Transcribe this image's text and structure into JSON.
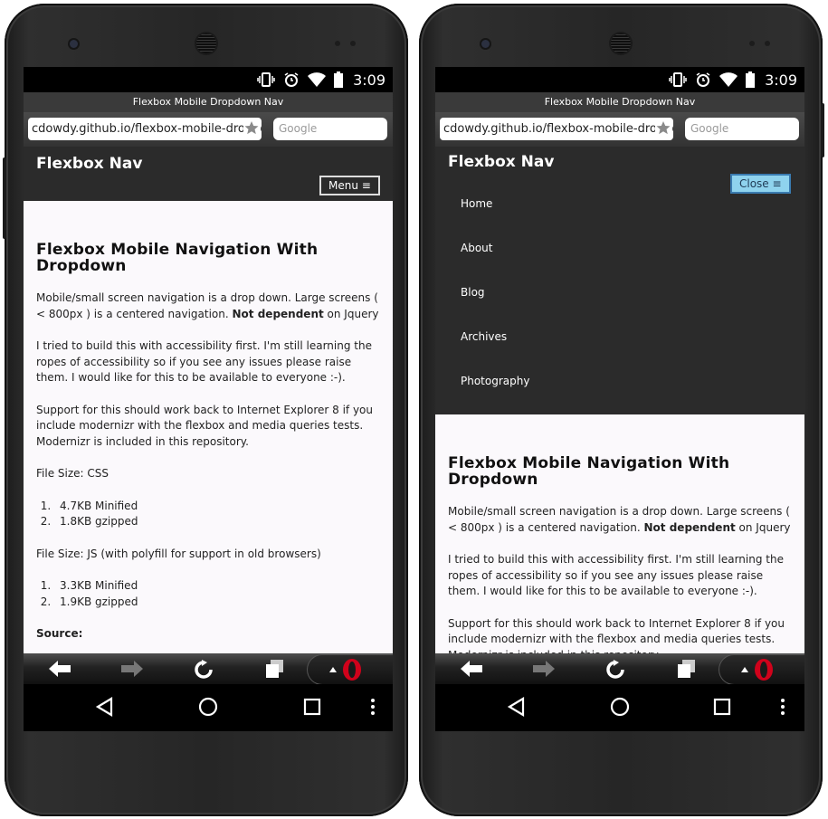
{
  "status": {
    "time": "3:09"
  },
  "browser": {
    "tab_title": "Flexbox Mobile Dropdown Nav",
    "url": "cdowdy.github.io/flexbox-mobile-dropdown",
    "search_placeholder": "Google"
  },
  "site": {
    "brand": "Flexbox Nav",
    "menu_label": "Menu ≡",
    "close_label": "Close ≡",
    "nav_items": [
      "Home",
      "About",
      "Blog",
      "Archives",
      "Photography"
    ]
  },
  "article": {
    "title": "Flexbox Mobile Navigation With Dropdown",
    "p1_start": "Mobile/small screen navigation is a drop down. Large screens ( < 800px ) is a centered navigation. ",
    "p1_bold": "Not dependent",
    "p1_end": " on Jquery",
    "p2": "I tried to build this with accessibility first. I'm  still learning the ropes of accessibility so if you see any issues please raise them. I would like for this to be available to everyone :-).",
    "p3": "Support for this should work back to Internet Explorer 8 if you include modernizr with the flexbox and media queries tests. Modernizr is included in this repository.",
    "css_heading": "File Size: CSS",
    "css_items": [
      "4.7KB Minified",
      "1.8KB gzipped"
    ],
    "js_heading": "File Size: JS  (with polyfill for support in old browsers)",
    "js_items": [
      "3.3KB Minified",
      "1.9KB gzipped"
    ],
    "source_heading": "Source:"
  },
  "colors": {
    "close_bg": "#8fd3ee",
    "nav_bg": "#2b2b2b",
    "opera_red": "#d0021b"
  }
}
